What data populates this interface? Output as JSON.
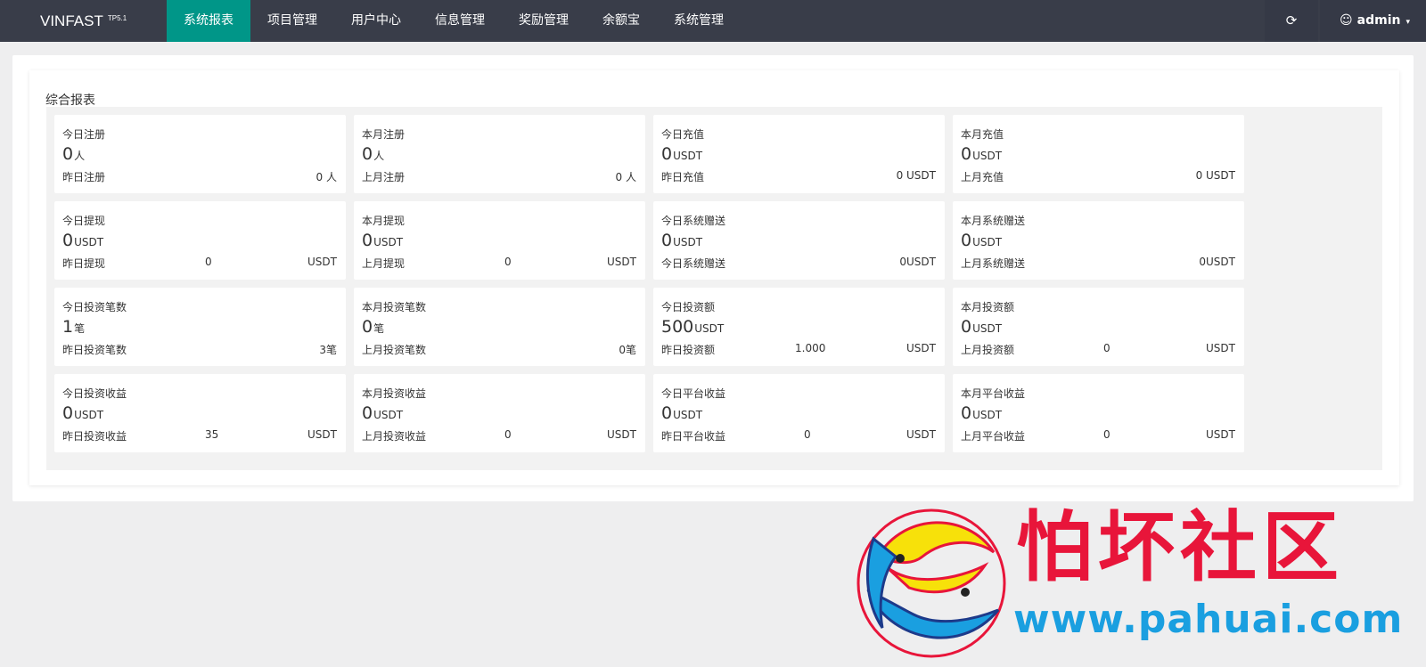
{
  "app": {
    "logo": "VINFAST",
    "version": "TP5.1"
  },
  "nav": [
    {
      "label": "系统报表",
      "active": true
    },
    {
      "label": "项目管理"
    },
    {
      "label": "用户中心"
    },
    {
      "label": "信息管理"
    },
    {
      "label": "奖励管理"
    },
    {
      "label": "余额宝"
    },
    {
      "label": "系统管理"
    }
  ],
  "toolbar": {
    "refresh_icon": "refresh-icon",
    "user_icon": "user-icon",
    "user_name": "admin",
    "user_caret": "▾"
  },
  "panel": {
    "title": "综合报表"
  },
  "stats": [
    {
      "label": "今日注册",
      "value": "0",
      "unit": "人",
      "sub_label": "昨日注册",
      "sub_value": "",
      "sub_right": "0 人"
    },
    {
      "label": "本月注册",
      "value": "0",
      "unit": "人",
      "sub_label": "上月注册",
      "sub_value": "",
      "sub_right": "0 人"
    },
    {
      "label": "今日充值",
      "value": "0",
      "unit": "USDT",
      "sub_label": "昨日充值",
      "sub_value": "",
      "sub_right": "0 USDT"
    },
    {
      "label": "本月充值",
      "value": "0",
      "unit": "USDT",
      "sub_label": "上月充值",
      "sub_value": "",
      "sub_right": "0 USDT"
    },
    {
      "label": "今日提现",
      "value": "0",
      "unit": "USDT",
      "sub_label": "昨日提现",
      "sub_value": "0",
      "sub_right": "USDT"
    },
    {
      "label": "本月提现",
      "value": "0",
      "unit": "USDT",
      "sub_label": "上月提现",
      "sub_value": "0",
      "sub_right": "USDT"
    },
    {
      "label": "今日系统赠送",
      "value": "0",
      "unit": "USDT",
      "sub_label": "今日系统赠送",
      "sub_value": "",
      "sub_right": "0USDT"
    },
    {
      "label": "本月系统赠送",
      "value": "0",
      "unit": "USDT",
      "sub_label": "上月系统赠送",
      "sub_value": "",
      "sub_right": "0USDT"
    },
    {
      "label": "今日投资笔数",
      "value": "1",
      "unit": "笔",
      "sub_label": "昨日投资笔数",
      "sub_value": "",
      "sub_right": "3笔"
    },
    {
      "label": "本月投资笔数",
      "value": "0",
      "unit": "笔",
      "sub_label": "上月投资笔数",
      "sub_value": "",
      "sub_right": "0笔"
    },
    {
      "label": "今日投资额",
      "value": "500",
      "unit": "USDT",
      "sub_label": "昨日投资额",
      "sub_value": "1.000",
      "sub_right": "USDT"
    },
    {
      "label": "本月投资额",
      "value": "0",
      "unit": "USDT",
      "sub_label": "上月投资额",
      "sub_value": "0",
      "sub_right": "USDT"
    },
    {
      "label": "今日投资收益",
      "value": "0",
      "unit": "USDT",
      "sub_label": "昨日投资收益",
      "sub_value": "35",
      "sub_right": "USDT"
    },
    {
      "label": "本月投资收益",
      "value": "0",
      "unit": "USDT",
      "sub_label": "上月投资收益",
      "sub_value": "0",
      "sub_right": "USDT"
    },
    {
      "label": "今日平台收益",
      "value": "0",
      "unit": "USDT",
      "sub_label": "昨日平台收益",
      "sub_value": "0",
      "sub_right": "USDT"
    },
    {
      "label": "本月平台收益",
      "value": "0",
      "unit": "USDT",
      "sub_label": "上月平台收益",
      "sub_value": "0",
      "sub_right": "USDT"
    }
  ],
  "watermark": {
    "title": "怕坏社区",
    "url": "www.pahuai.com",
    "logo": "two-fish-logo",
    "colors": {
      "red": "#e8153a",
      "blue": "#1a9fe0",
      "yellow": "#f7e10a"
    }
  }
}
